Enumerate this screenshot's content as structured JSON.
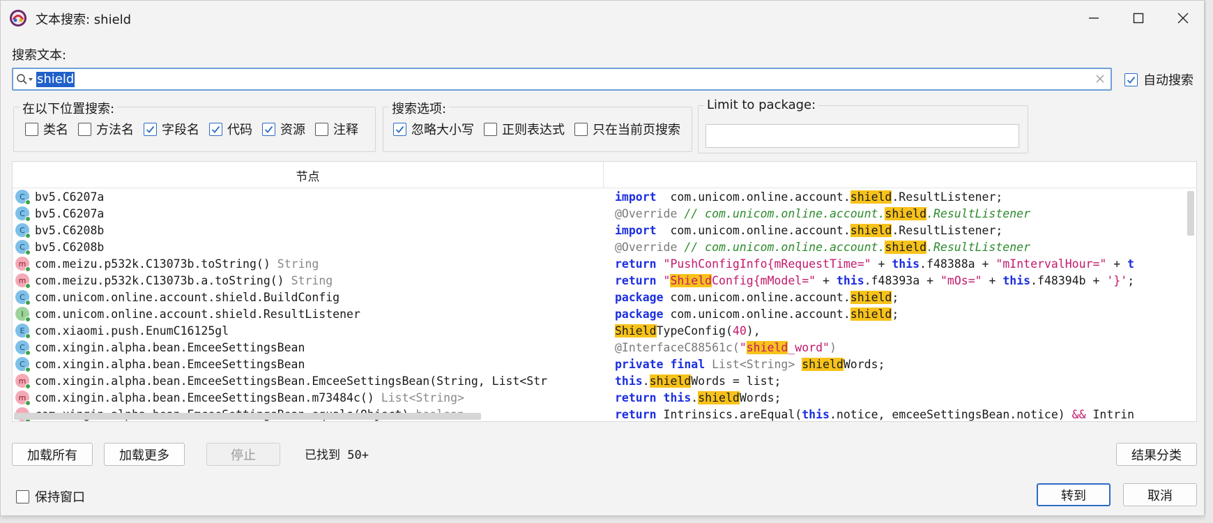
{
  "window": {
    "title": "文本搜索: shield"
  },
  "search": {
    "label": "搜索文本:",
    "value": "shield",
    "auto_search_label": "自动搜索",
    "auto_search_checked": true
  },
  "location_group": {
    "title": "在以下位置搜索:",
    "options": [
      {
        "label": "类名",
        "checked": false
      },
      {
        "label": "方法名",
        "checked": false
      },
      {
        "label": "字段名",
        "checked": true
      },
      {
        "label": "代码",
        "checked": true
      },
      {
        "label": "资源",
        "checked": true
      },
      {
        "label": "注释",
        "checked": false
      }
    ]
  },
  "search_options_group": {
    "title": "搜索选项:",
    "options": [
      {
        "label": "忽略大小写",
        "checked": true
      },
      {
        "label": "正则表达式",
        "checked": false
      },
      {
        "label": "只在当前页搜索",
        "checked": false
      }
    ]
  },
  "package_group": {
    "title": "Limit to package:",
    "value": ""
  },
  "results": {
    "column_node": "节点",
    "rows": [
      {
        "badge": "C",
        "node": "bv5.C6207a",
        "rtype": ""
      },
      {
        "badge": "C",
        "node": "bv5.C6207a",
        "rtype": ""
      },
      {
        "badge": "C",
        "node": "bv5.C6208b",
        "rtype": ""
      },
      {
        "badge": "C",
        "node": "bv5.C6208b",
        "rtype": ""
      },
      {
        "badge": "m",
        "node": "com.meizu.p532k.C13073b.toString()",
        "rtype": "String"
      },
      {
        "badge": "m",
        "node": "com.meizu.p532k.C13073b.a.toString()",
        "rtype": "String"
      },
      {
        "badge": "C",
        "node": "com.unicom.online.account.shield.BuildConfig",
        "rtype": ""
      },
      {
        "badge": "I",
        "node": "com.unicom.online.account.shield.ResultListener",
        "rtype": ""
      },
      {
        "badge": "E",
        "node": "com.xiaomi.push.EnumC16125gl",
        "rtype": ""
      },
      {
        "badge": "C",
        "node": "com.xingin.alpha.bean.EmceeSettingsBean",
        "rtype": ""
      },
      {
        "badge": "C",
        "node": "com.xingin.alpha.bean.EmceeSettingsBean",
        "rtype": ""
      },
      {
        "badge": "m",
        "node": "com.xingin.alpha.bean.EmceeSettingsBean.EmceeSettingsBean(String, List<Str",
        "rtype": ""
      },
      {
        "badge": "m",
        "node": "com.xingin.alpha.bean.EmceeSettingsBean.m73484c()",
        "rtype": "List<String>"
      },
      {
        "badge": "m",
        "node": "com.xingin.alpha.bean.EmceeSettingsBean.equals(Object)",
        "rtype": "boolean"
      }
    ],
    "code": [
      [
        [
          "kw",
          "import"
        ],
        [
          "",
          "  com.unicom.online.account."
        ],
        [
          "hl",
          "shield"
        ],
        [
          "",
          ".ResultListener;"
        ]
      ],
      [
        [
          "ann",
          "@Override"
        ],
        [
          "cmt",
          " // com.unicom.online.account."
        ],
        [
          "hl",
          "shield"
        ],
        [
          "cmt",
          ".ResultListener"
        ]
      ],
      [
        [
          "kw",
          "import"
        ],
        [
          "",
          "  com.unicom.online.account."
        ],
        [
          "hl",
          "shield"
        ],
        [
          "",
          ".ResultListener;"
        ]
      ],
      [
        [
          "ann",
          "@Override"
        ],
        [
          "cmt",
          " // com.unicom.online.account."
        ],
        [
          "hl",
          "shield"
        ],
        [
          "cmt",
          ".ResultListener"
        ]
      ],
      [
        [
          "kw",
          "return"
        ],
        [
          "",
          " "
        ],
        [
          "str",
          "\"PushConfigInfo{mRequestTime=\""
        ],
        [
          "",
          " + "
        ],
        [
          "kw",
          "this"
        ],
        [
          "",
          ".f48388a + "
        ],
        [
          "str",
          "\"mIntervalHour=\""
        ],
        [
          "",
          " + "
        ],
        [
          "kw",
          "t"
        ]
      ],
      [
        [
          "kw",
          "return"
        ],
        [
          "",
          " "
        ],
        [
          "str",
          "\""
        ],
        [
          "hlr",
          "Shield"
        ],
        [
          "str",
          "Config{mModel=\""
        ],
        [
          "",
          " + "
        ],
        [
          "kw",
          "this"
        ],
        [
          "",
          ".f48393a + "
        ],
        [
          "str",
          "\"mOs=\""
        ],
        [
          "",
          " + "
        ],
        [
          "kw",
          "this"
        ],
        [
          "",
          ".f48394b + "
        ],
        [
          "str",
          "'}'"
        ],
        [
          "",
          ";"
        ]
      ],
      [
        [
          "kw",
          "package"
        ],
        [
          "",
          " com.unicom.online.account."
        ],
        [
          "hl",
          "shield"
        ],
        [
          "",
          ";"
        ]
      ],
      [
        [
          "kw",
          "package"
        ],
        [
          "",
          " com.unicom.online.account."
        ],
        [
          "hl",
          "shield"
        ],
        [
          "",
          ";"
        ]
      ],
      [
        [
          "hl",
          "Shield"
        ],
        [
          "",
          "TypeConfig("
        ],
        [
          "num",
          "40"
        ],
        [
          "",
          "),"
        ]
      ],
      [
        [
          "ann",
          "@InterfaceC88561c("
        ],
        [
          "str",
          "\""
        ],
        [
          "hlr",
          "shield"
        ],
        [
          "str",
          "_word\""
        ],
        [
          "ann",
          ")"
        ]
      ],
      [
        [
          "kw",
          "private final"
        ],
        [
          "",
          " "
        ],
        [
          "ann",
          "List<String>"
        ],
        [
          "",
          " "
        ],
        [
          "hl",
          "shield"
        ],
        [
          "",
          "Words;"
        ]
      ],
      [
        [
          "kw",
          "this"
        ],
        [
          "",
          "."
        ],
        [
          "hl",
          "shield"
        ],
        [
          "",
          "Words = list;"
        ]
      ],
      [
        [
          "kw",
          "return this"
        ],
        [
          "",
          "."
        ],
        [
          "hl",
          "shield"
        ],
        [
          "",
          "Words;"
        ]
      ],
      [
        [
          "kw",
          "return"
        ],
        [
          "",
          " Intrinsics.areEqual("
        ],
        [
          "kw",
          "this"
        ],
        [
          "",
          ".notice, emceeSettingsBean.notice) "
        ],
        [
          "str",
          "&&"
        ],
        [
          "",
          " Intrin"
        ]
      ]
    ]
  },
  "buttons": {
    "load_all": "加载所有",
    "load_more": "加载更多",
    "stop": "停止",
    "found_text": "已找到  50+",
    "group_results": "结果分类",
    "goto": "转到",
    "cancel": "取消"
  },
  "keep_window": {
    "label": "保持窗口",
    "checked": false
  }
}
